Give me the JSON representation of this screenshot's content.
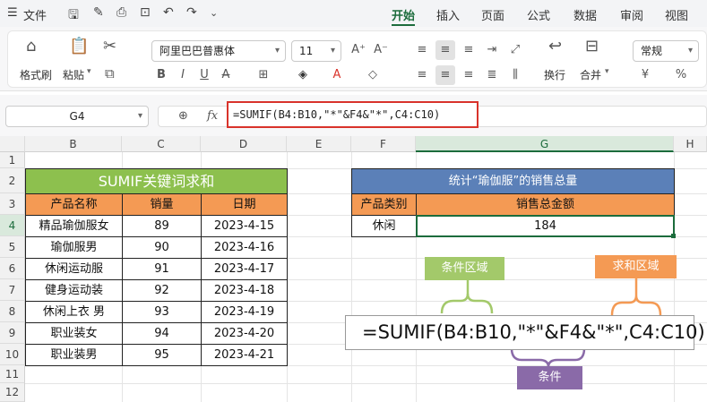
{
  "menubar": {
    "menu_icon": "hamburger-icon",
    "file_label": "文件",
    "tabs": [
      "开始",
      "插入",
      "页面",
      "公式",
      "数据",
      "审阅",
      "视图"
    ],
    "active_tab": "开始"
  },
  "ribbon": {
    "format_painter": "格式刷",
    "paste": "粘贴",
    "font_name": "阿里巴巴普惠体",
    "font_size": "11",
    "wrap": "换行",
    "merge": "合并",
    "number_format": "常规",
    "currency": "¥",
    "percent": "%"
  },
  "formulabar": {
    "cell_ref": "G4",
    "fx": "fx",
    "formula": "=SUMIF(B4:B10,\"*\"&F4&\"*\",C4:C10)"
  },
  "grid": {
    "columns": [
      "B",
      "C",
      "D",
      "E",
      "F",
      "G",
      "H"
    ],
    "rows": [
      "1",
      "2",
      "3",
      "4",
      "5",
      "6",
      "7",
      "8",
      "9",
      "10",
      "11",
      "12"
    ],
    "selected_col": "G",
    "selected_row": "4"
  },
  "left_table": {
    "title": "SUMIF关键词求和",
    "headers": [
      "产品名称",
      "销量",
      "日期"
    ],
    "rows": [
      [
        "精品瑜伽服女",
        "89",
        "2023-4-15"
      ],
      [
        "瑜伽服男",
        "90",
        "2023-4-16"
      ],
      [
        "休闲运动服",
        "91",
        "2023-4-17"
      ],
      [
        "健身运动装",
        "92",
        "2023-4-18"
      ],
      [
        "休闲上衣 男",
        "93",
        "2023-4-19"
      ],
      [
        "职业装女",
        "94",
        "2023-4-20"
      ],
      [
        "职业装男",
        "95",
        "2023-4-21"
      ]
    ]
  },
  "right_table": {
    "title": "统计“瑜伽服”的销售总量",
    "headers": [
      "产品类别",
      "销售总金额"
    ],
    "category": "休闲",
    "total": "184"
  },
  "annotations": {
    "criteria_range": "条件区域",
    "sum_range": "求和区域",
    "criteria": "条件",
    "formula": "=SUMIF(B4:B10,\"*\"&F4&\"*\",C4:C10)"
  },
  "colors": {
    "green": "#8dc04e",
    "orange": "#f49a54",
    "blue": "#5b80b8",
    "purple": "#8a6aa8",
    "accent": "#1c6c3c",
    "formula_border": "#d9332b"
  }
}
